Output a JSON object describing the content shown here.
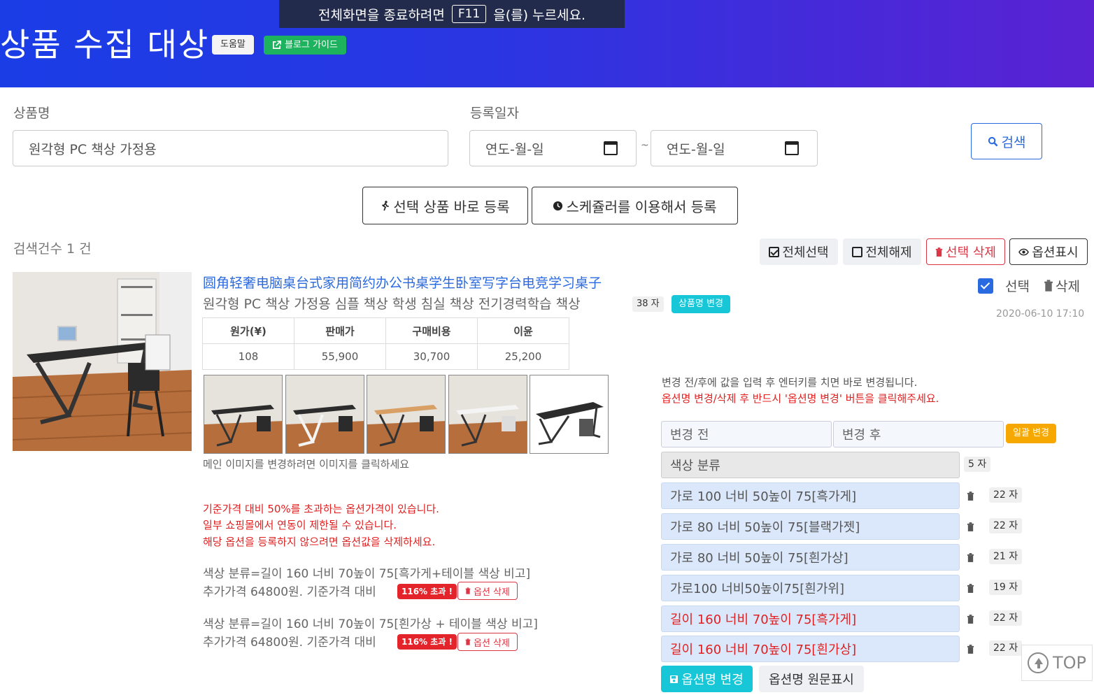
{
  "header": {
    "title": "상품 수집 대상",
    "help_label": "도움말",
    "blog_label": "블로그 가이드"
  },
  "fullscreen_notice": {
    "prefix": "전체화면을 종료하려면",
    "key": "F11",
    "suffix": "을(를) 누르세요."
  },
  "search": {
    "product_name_label": "상품명",
    "product_name_value": "원각형 PC 책상 가정용",
    "date_label": "등록일자",
    "date_from_placeholder": "연도-월-일",
    "date_to_placeholder": "연도-월-일",
    "date_separator": "~",
    "search_button": "검색"
  },
  "actions": {
    "register_now": "선택 상품 바로 등록",
    "register_scheduler": "스케쥴러를 이용해서 등록"
  },
  "results": {
    "count_text": "검색건수 1 건",
    "select_all": "전체선택",
    "deselect_all": "전체해제",
    "delete_selected": "선택 삭제",
    "show_options": "옵션표시"
  },
  "product": {
    "cn_title": "圆角轻奢电脑桌台式家用简约办公书桌学生卧室写字台电竞学习桌子",
    "kr_title": "원각형 PC 책상 가정용 심플 책상 학생 침실 책상 전기경력학습 책상",
    "char_count": "38 자",
    "rename_button": "상품명 변경",
    "select_label": "선택",
    "delete_label": "삭제",
    "date": "2020-06-10 17:10",
    "price_table": {
      "headers": [
        "원가(¥)",
        "판매가",
        "구매비용",
        "이윤"
      ],
      "values": [
        "108",
        "55,900",
        "30,700",
        "25,200"
      ]
    },
    "thumb_hint": "메인 이미지를 변경하려면 이미지를 클릭하세요",
    "warnings": [
      "기준가격 대비 50%를 초과하는 옵션가격이 있습니다.",
      "일부 쇼핑몰에서 연동이 제한될 수 있습니다.",
      "해당 옵션을 등록하지 않으려면 옵션값을 삭제하세요."
    ],
    "over_options": [
      {
        "name": "색상 분류=길이 160 너비 70높이 75[흑가게+테이블 색상 비고]",
        "price_text": "추가가격 64800원. 기준가격 대비",
        "over_badge": "116% 초과 !",
        "delete_label": "옵션 삭제"
      },
      {
        "name": "색상 분류=길이 160 너비 70높이 75[흰가상 + 테이블 색상 비고]",
        "price_text": "추가가격 64800원. 기준가격 대비",
        "over_badge": "116% 초과 !",
        "delete_label": "옵션 삭제"
      }
    ]
  },
  "options_panel": {
    "info_line1": "변경 전/후에 값을 입력 후 엔터키를 치면 바로 변경됩니다.",
    "info_line2": "옵션명 변경/삭제 후 반드시 '옵션명 변경' 버튼을 클릭해주세요.",
    "before_placeholder": "변경 전",
    "after_placeholder": "변경 후",
    "bulk_change": "일괄 변경",
    "category": {
      "value": "색상 분류",
      "count": "5 자"
    },
    "items": [
      {
        "value": "가로 100 너비 50높이 75[흑가게]",
        "count": "22 자",
        "highlight": false
      },
      {
        "value": "가로 80 너비 50높이 75[블랙가젯]",
        "count": "22 자",
        "highlight": false
      },
      {
        "value": "가로 80 너비 50높이 75[흰가상]",
        "count": "21 자",
        "highlight": false
      },
      {
        "value": "가로100 너비50높이75[흰가위]",
        "count": "19 자",
        "highlight": false
      },
      {
        "value": "길이 160 너비 70높이 75[흑가게]",
        "count": "22 자",
        "highlight": true
      },
      {
        "value": "길이 160 너비 70높이 75[흰가상]",
        "count": "22 자",
        "highlight": true
      }
    ],
    "rename_options_button": "옵션명 변경",
    "show_original_button": "옵션명 원문표시"
  },
  "top_button": "TOP",
  "colors": {
    "header_start": "#1a3de6",
    "header_end": "#5a22d2",
    "primary": "#2a6ae0",
    "danger": "#dc3545",
    "cyan": "#17c7d7",
    "warning": "#f7a800",
    "success": "#1db35e"
  }
}
